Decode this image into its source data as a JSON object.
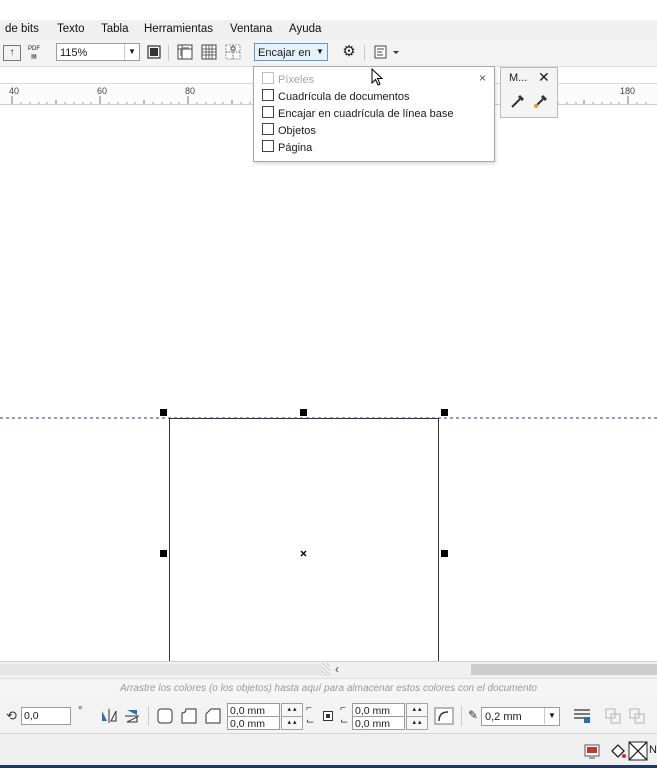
{
  "menu": {
    "items": [
      "de bits",
      "Texto",
      "Tabla",
      "Herramientas",
      "Ventana",
      "Ayuda"
    ]
  },
  "toolbar": {
    "zoom_value": "115%",
    "snap_label": "Encajar en",
    "pdf_label": "PDF"
  },
  "ruler": {
    "ticks": [
      "40",
      "60",
      "80",
      "180"
    ]
  },
  "snap_menu": {
    "options": [
      {
        "label": "Píxeles",
        "checked": false,
        "disabled": true
      },
      {
        "label": "Cuadrícula de documentos",
        "checked": false,
        "disabled": false
      },
      {
        "label": "Encajar en cuadrícula de línea base",
        "checked": false,
        "disabled": false
      },
      {
        "label": "Objetos",
        "checked": false,
        "disabled": false
      },
      {
        "label": "Página",
        "checked": false,
        "disabled": false
      }
    ],
    "close_glyph": "×"
  },
  "mini_docker": {
    "title": "M...",
    "close_glyph": "✕"
  },
  "palette_hint": "Arrastre los colores (o los objetos) hasta aquí para almacenar estos colores con el documento",
  "propbar": {
    "angle_value": "0,0",
    "degree_symbol": "°",
    "corner_w": "0,0 mm",
    "corner_h": "0,0 mm",
    "corner_w2": "0,0 mm",
    "corner_h2": "0,0 mm",
    "outline_width": "0,2 mm"
  },
  "status": {
    "fill_label": "N"
  },
  "colors": {
    "accent": "#0078d7",
    "menu_bg": "#f0f0f0",
    "handle": "#000000"
  }
}
